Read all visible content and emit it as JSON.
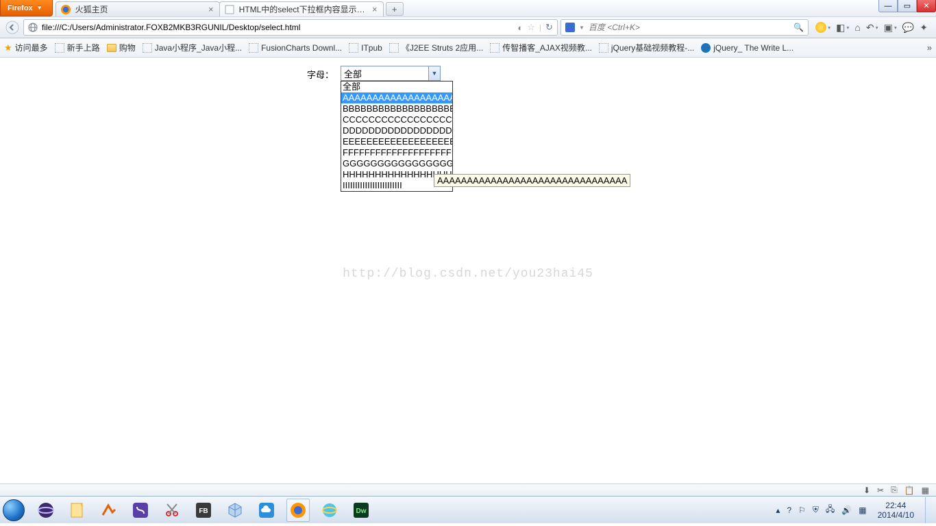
{
  "window": {
    "firefox_button": "Firefox",
    "tabs": [
      {
        "label": "火狐主页",
        "active": false
      },
      {
        "label": "HTML中的select下拉框内容显示不...",
        "active": true
      }
    ]
  },
  "addressbar": {
    "url": "file:///C:/Users/Administrator.FOXB2MKB3RGUNIL/Desktop/select.html"
  },
  "searchbar": {
    "engine": "百度",
    "placeholder": "百度 <Ctrl+K>"
  },
  "bookmarks": [
    {
      "icon": "star",
      "label": "访问最多"
    },
    {
      "icon": "page",
      "label": "新手上路"
    },
    {
      "icon": "folder",
      "label": "购物"
    },
    {
      "icon": "page",
      "label": "Java小程序_Java小程..."
    },
    {
      "icon": "page",
      "label": "FusionCharts Downl..."
    },
    {
      "icon": "page",
      "label": "ITpub"
    },
    {
      "icon": "page",
      "label": "《J2EE Struts 2应用..."
    },
    {
      "icon": "page",
      "label": "传智播客_AJAX视频教..."
    },
    {
      "icon": "page",
      "label": "jQuery基础视频教程-..."
    },
    {
      "icon": "jquery",
      "label": "jQuery_ The Write L..."
    }
  ],
  "page": {
    "label": "字母：",
    "selected": "全部",
    "options": [
      "全部",
      "AAAAAAAAAAAAAAAAAAAAA",
      "BBBBBBBBBBBBBBBBBBBBBBBB",
      "CCCCCCCCCCCCCCCCCCCCCCCC",
      "DDDDDDDDDDDDDDDDDDDDDDDD",
      "EEEEEEEEEEEEEEEEEEEEEEEE",
      "FFFFFFFFFFFFFFFFFFFFFFFF",
      "GGGGGGGGGGGGGGGGGGGGG",
      "HHHHHHHHHHHHHHHHHHHHHH",
      "IIIIIIIIIIIIIIIIIIIIIIII"
    ],
    "highlighted_index": 1,
    "tooltip": "AAAAAAAAAAAAAAAAAAAAAAAAAAAAAAAA",
    "watermark": "http://blog.csdn.net/you23hai45"
  },
  "tray": {
    "time": "22:44",
    "date": "2014/4/10"
  }
}
